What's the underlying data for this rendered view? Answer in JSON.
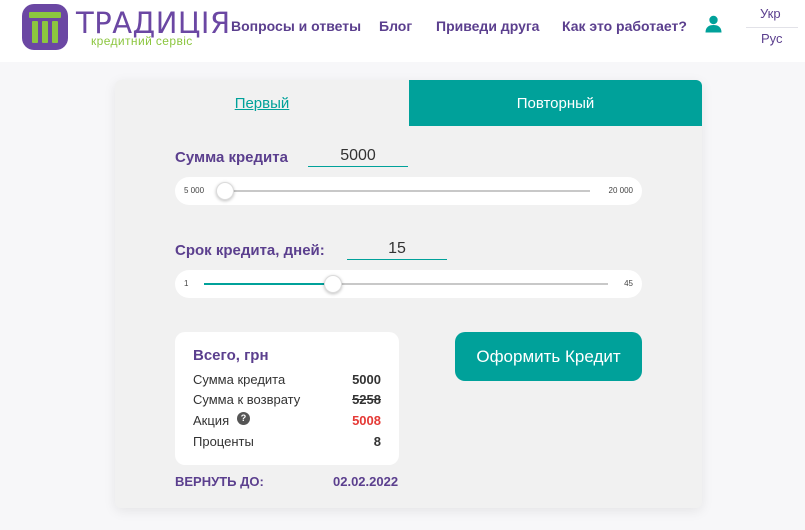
{
  "brand": {
    "name": "ТРАДИЦІЯ",
    "tagline": "кредитний сервіс",
    "colors": {
      "purple": "#6b47a3",
      "green": "#8cc63f",
      "teal": "#00a19a"
    }
  },
  "nav": {
    "items": [
      {
        "label": "Вопросы и ответы"
      },
      {
        "label": "Блог"
      },
      {
        "label": "Приведи друга"
      },
      {
        "label": "Как это работает?"
      }
    ],
    "user_icon": "user-icon",
    "languages": [
      "Укр",
      "Рус"
    ]
  },
  "tabs": {
    "first": "Первый",
    "repeat": "Повторный",
    "active": "repeat"
  },
  "amount": {
    "label": "Сумма кредита",
    "value": "5000",
    "min_label": "5 000",
    "max_label": "20 000",
    "min": 5000,
    "max": 20000,
    "current": 5000
  },
  "term": {
    "label": "Срок кредита, дней:",
    "value": "15",
    "min_label": "1",
    "max_label": "45",
    "min": 1,
    "max": 45,
    "current": 15
  },
  "summary": {
    "title": "Всего, грн",
    "rows": [
      {
        "label": "Сумма кредита",
        "value": "5000"
      },
      {
        "label": "Сумма к возврату",
        "value": "5258"
      },
      {
        "label": "Акция",
        "value": "5008"
      },
      {
        "label": "Проценты",
        "value": "8"
      }
    ],
    "help_icon": "question-icon"
  },
  "return": {
    "label": "ВЕРНУТЬ ДО:",
    "date": "02.02.2022"
  },
  "cta_label": "Оформить Кредит"
}
